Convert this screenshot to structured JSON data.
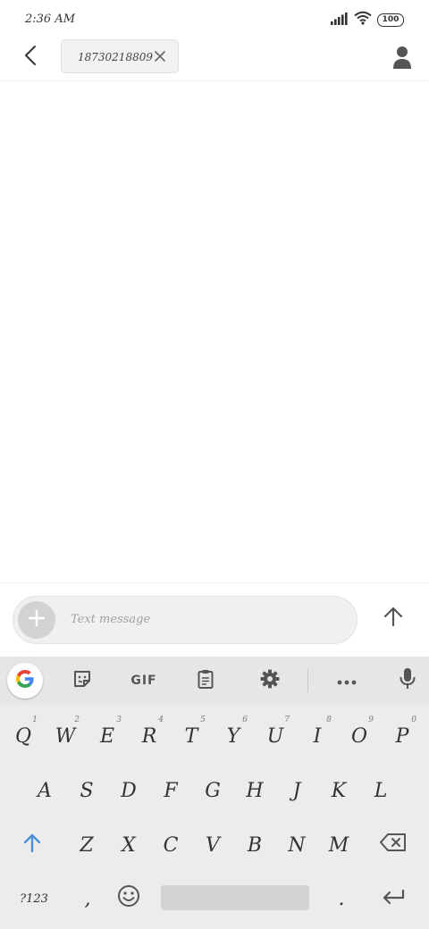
{
  "status_bar": {
    "time": "2:36 AM",
    "battery": "100",
    "icons": [
      "signal-icon",
      "wifi-icon",
      "battery-icon"
    ]
  },
  "header": {
    "recipient_chip": "18730218809",
    "icons": [
      "back-arrow-icon",
      "close-icon",
      "contact-person-icon"
    ]
  },
  "compose": {
    "placeholder": "Text message",
    "icons": [
      "plus-icon",
      "send-arrow-icon"
    ]
  },
  "keyboard": {
    "toolbar": {
      "gif_label": "GIF",
      "icons": [
        "google-g-icon",
        "sticker-icon",
        "clipboard-icon",
        "settings-gear-icon",
        "more-dots-icon",
        "microphone-icon"
      ]
    },
    "row1": [
      {
        "key": "Q",
        "hint": "1"
      },
      {
        "key": "W",
        "hint": "2"
      },
      {
        "key": "E",
        "hint": "3"
      },
      {
        "key": "R",
        "hint": "4"
      },
      {
        "key": "T",
        "hint": "5"
      },
      {
        "key": "Y",
        "hint": "6"
      },
      {
        "key": "U",
        "hint": "7"
      },
      {
        "key": "I",
        "hint": "8"
      },
      {
        "key": "O",
        "hint": "9"
      },
      {
        "key": "P",
        "hint": "0"
      }
    ],
    "row2": [
      "A",
      "S",
      "D",
      "F",
      "G",
      "H",
      "J",
      "K",
      "L"
    ],
    "row3": [
      "Z",
      "X",
      "C",
      "V",
      "B",
      "N",
      "M"
    ],
    "bottom": {
      "symbols": "?123",
      "comma": ",",
      "period": "."
    },
    "accent_color": "#4a90d9"
  }
}
